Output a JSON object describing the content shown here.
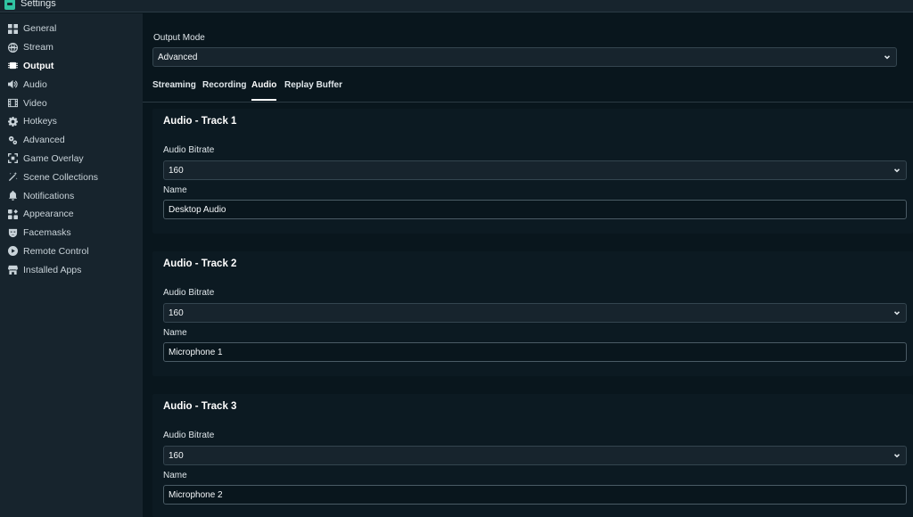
{
  "window": {
    "title": "Settings"
  },
  "sidebar": {
    "items": [
      {
        "label": "General",
        "icon": "grid-icon",
        "active": false
      },
      {
        "label": "Stream",
        "icon": "globe-icon",
        "active": false
      },
      {
        "label": "Output",
        "icon": "chip-icon",
        "active": true
      },
      {
        "label": "Audio",
        "icon": "speaker-icon",
        "active": false
      },
      {
        "label": "Video",
        "icon": "film-icon",
        "active": false
      },
      {
        "label": "Hotkeys",
        "icon": "gear-icon",
        "active": false
      },
      {
        "label": "Advanced",
        "icon": "gears-icon",
        "active": false
      },
      {
        "label": "Game Overlay",
        "icon": "overlay-icon",
        "active": false
      },
      {
        "label": "Scene Collections",
        "icon": "wand-icon",
        "active": false
      },
      {
        "label": "Notifications",
        "icon": "bell-icon",
        "active": false
      },
      {
        "label": "Appearance",
        "icon": "apps-icon",
        "active": false
      },
      {
        "label": "Facemasks",
        "icon": "mask-icon",
        "active": false
      },
      {
        "label": "Remote Control",
        "icon": "play-circle-icon",
        "active": false
      },
      {
        "label": "Installed Apps",
        "icon": "store-icon",
        "active": false
      }
    ]
  },
  "output": {
    "mode_label": "Output Mode",
    "mode_value": "Advanced"
  },
  "tabs": [
    {
      "label": "Streaming",
      "active": false
    },
    {
      "label": "Recording",
      "active": false
    },
    {
      "label": "Audio",
      "active": true
    },
    {
      "label": "Replay Buffer",
      "active": false
    }
  ],
  "tracks": [
    {
      "title": "Audio - Track 1",
      "bitrate_label": "Audio Bitrate",
      "bitrate_value": "160",
      "name_label": "Name",
      "name_value": "Desktop Audio"
    },
    {
      "title": "Audio - Track 2",
      "bitrate_label": "Audio Bitrate",
      "bitrate_value": "160",
      "name_label": "Name",
      "name_value": "Microphone 1"
    },
    {
      "title": "Audio - Track 3",
      "bitrate_label": "Audio Bitrate",
      "bitrate_value": "160",
      "name_label": "Name",
      "name_value": "Microphone 2"
    }
  ],
  "colors": {
    "accent": "#31c3a2",
    "sidebar_bg": "#17242d",
    "content_bg": "#09161d"
  }
}
